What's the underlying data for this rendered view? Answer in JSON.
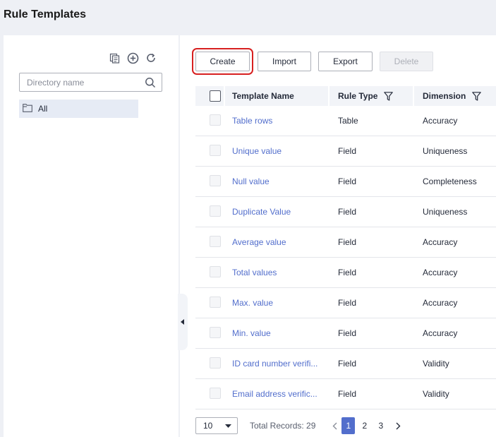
{
  "page": {
    "title": "Rule Templates"
  },
  "directory": {
    "search_placeholder": "Directory name",
    "items": [
      {
        "label": "All"
      }
    ]
  },
  "toolbar": {
    "create_label": "Create",
    "import_label": "Import",
    "export_label": "Export",
    "delete_label": "Delete"
  },
  "table": {
    "columns": {
      "name": "Template Name",
      "rule_type": "Rule Type",
      "dimension": "Dimension"
    },
    "rows": [
      {
        "name": "Table rows",
        "rule_type": "Table",
        "dimension": "Accuracy"
      },
      {
        "name": "Unique value",
        "rule_type": "Field",
        "dimension": "Uniqueness"
      },
      {
        "name": "Null value",
        "rule_type": "Field",
        "dimension": "Completeness"
      },
      {
        "name": "Duplicate Value",
        "rule_type": "Field",
        "dimension": "Uniqueness"
      },
      {
        "name": "Average value",
        "rule_type": "Field",
        "dimension": "Accuracy"
      },
      {
        "name": "Total values",
        "rule_type": "Field",
        "dimension": "Accuracy"
      },
      {
        "name": "Max. value",
        "rule_type": "Field",
        "dimension": "Accuracy"
      },
      {
        "name": "Min. value",
        "rule_type": "Field",
        "dimension": "Accuracy"
      },
      {
        "name": "ID card number verifi...",
        "rule_type": "Field",
        "dimension": "Validity"
      },
      {
        "name": "Email address verific...",
        "rule_type": "Field",
        "dimension": "Validity"
      }
    ]
  },
  "pagination": {
    "page_size": "10",
    "total_label": "Total Records: 29",
    "pages": [
      "1",
      "2",
      "3"
    ],
    "current_page": "1"
  },
  "colors": {
    "accent": "#526ecc",
    "highlight_border": "#d72020"
  }
}
